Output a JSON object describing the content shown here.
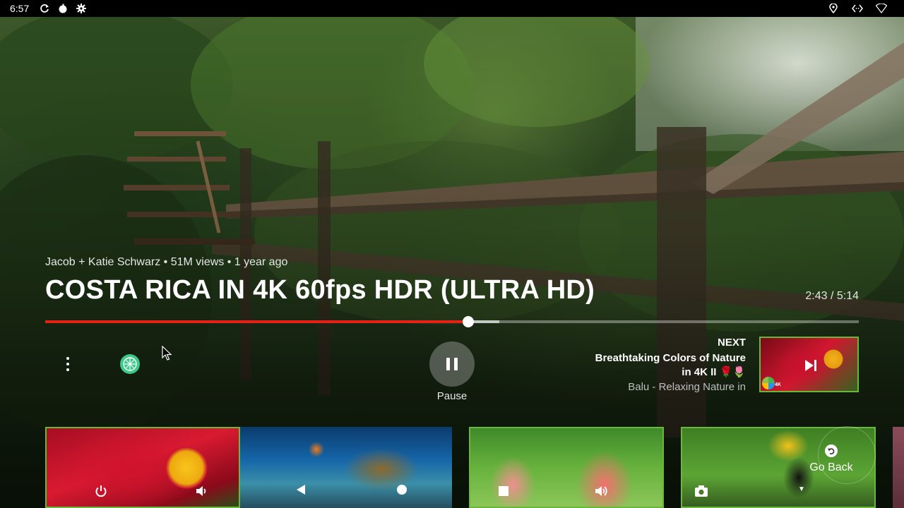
{
  "status_bar": {
    "time": "6:57",
    "left_icons": [
      "refresh-icon",
      "apple-icon",
      "gear-icon"
    ],
    "right_icons": [
      "location-icon",
      "code-icon",
      "wifi-icon"
    ]
  },
  "video": {
    "meta": "Jacob + Katie Schwarz • 51M views • 1 year ago",
    "title": "COSTA RICA IN 4K 60fps HDR (ULTRA HD)",
    "time_readout": "2:43 / 5:14",
    "progress_fraction": 0.52,
    "buffered_fraction": 0.558
  },
  "controls": {
    "pause_label": "Pause"
  },
  "next_up": {
    "label": "NEXT",
    "title": "Breathtaking Colors of Nature in 4K II 🌹🌷",
    "channel": "Balu - Relaxing Nature in",
    "badge_text": "4K"
  },
  "rail": {
    "go_back_label": "Go Back"
  },
  "colors": {
    "progress_played": "#e62117",
    "card_border": "#6ab83a"
  }
}
